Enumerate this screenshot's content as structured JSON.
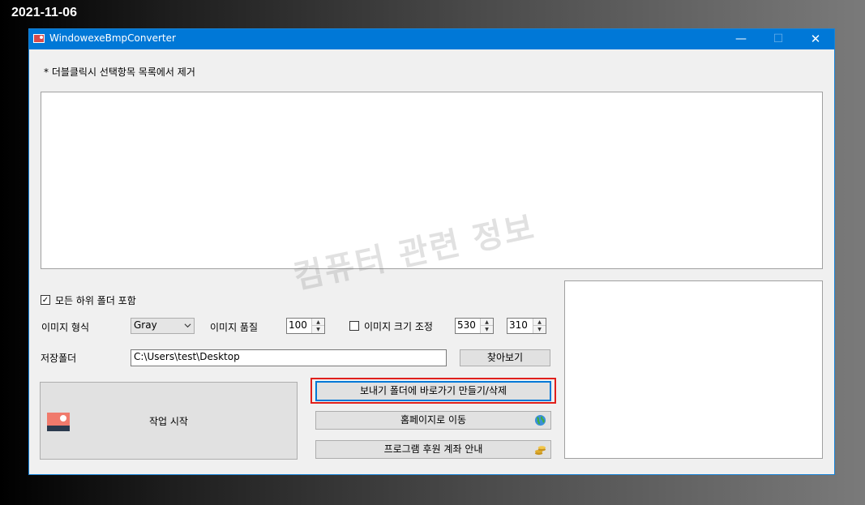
{
  "date_stamp": "2021-11-06",
  "window": {
    "title": "WindowexeBmpConverter",
    "minimize_glyph": "—",
    "maximize_glyph": "☐",
    "close_glyph": "✕"
  },
  "hint_label": "* 더블클릭시 선택항목 목록에서 제거",
  "options": {
    "subfolder_checked": true,
    "subfolder_check_glyph": "✓",
    "subfolder_label": "모든 하위 폴더 포함",
    "format_label": "이미지 형식",
    "format_value": "Gray",
    "quality_label": "이미지 품질",
    "quality_value": "100",
    "resize_checked": false,
    "resize_label": "이미지 크기 조정",
    "width_value": "530",
    "height_value": "310",
    "spin_up_glyph": "▲",
    "spin_down_glyph": "▼"
  },
  "save_folder": {
    "label": "저장폴더",
    "path": "C:\\Users\\test\\Desktop",
    "browse_label": "찾아보기"
  },
  "buttons": {
    "start_label": "작업 시작",
    "sendto_label": "보내기 폴더에 바로가기 만들기/삭제",
    "homepage_label": "홈페이지로 이동",
    "sponsor_label": "프로그램 후원 계좌 안내"
  },
  "watermark": "컴퓨터 관련 정보",
  "icons": {
    "app": "app-icon",
    "start": "image-icon",
    "homepage": "globe-icon",
    "sponsor": "coins-icon"
  },
  "colors": {
    "titlebar": "#0078d7",
    "highlight": "#e0201c",
    "window_bg": "#f0f0f0"
  }
}
